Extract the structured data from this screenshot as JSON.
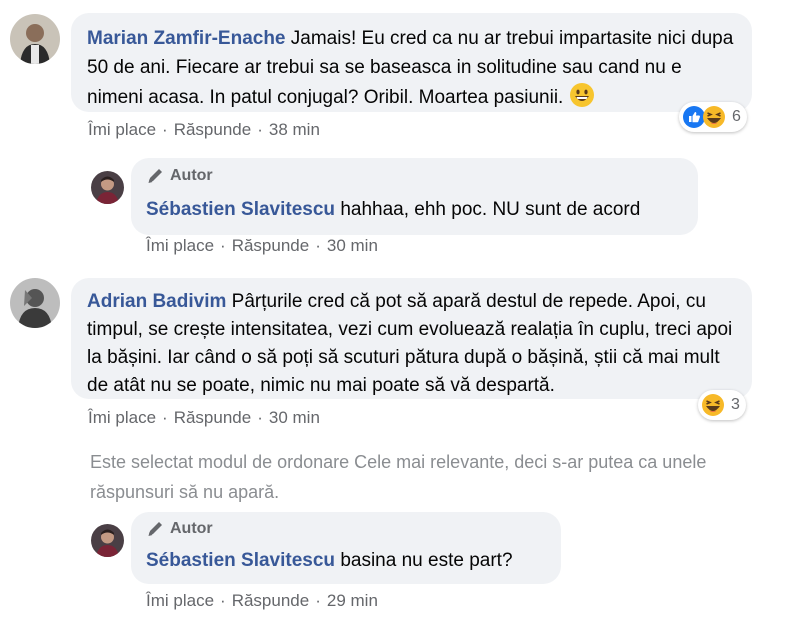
{
  "comments": [
    {
      "author": "Marian Zamfir-Enache",
      "text": "Jamais! Eu cred ca nu ar trebui impartasite nici dupa 50 de ani. Fiecare ar trebui sa se baseasca in solitudine sau cand nu e nimeni acasa. In patul conjugal? Oribil. Moartea pasiunii.",
      "like_label": "Îmi place",
      "reply_label": "Răspunde",
      "time": "38 min",
      "reaction_count": "6",
      "reaction_icons": [
        "like-icon",
        "haha-icon"
      ],
      "inline_emoji": "grinning-emoji-icon"
    },
    {
      "badge": "Autor",
      "author": "Sébastien Slavitescu",
      "text": "hahhaa, ehh poc. NU sunt de acord",
      "like_label": "Îmi place",
      "reply_label": "Răspunde",
      "time": "30 min"
    },
    {
      "author": "Adrian Badivim",
      "text": "Pârțurile cred că pot să apară destul de repede. Apoi, cu timpul, se crește intensitatea, vezi cum evoluează realația în cuplu, treci apoi la bășini. Iar când o să poți să scuturi pătura după o bășină, știi că mai mult de atât nu se poate, nimic nu mai poate să vă despartă.",
      "like_label": "Îmi place",
      "reply_label": "Răspunde",
      "time": "30 min",
      "reaction_count": "3",
      "reaction_icons": [
        "haha-icon"
      ]
    },
    {
      "badge": "Autor",
      "author": "Sébastien Slavitescu",
      "text": "basina nu este part?",
      "like_label": "Îmi place",
      "reply_label": "Răspunde",
      "time": "29 min"
    }
  ],
  "notice": "Este selectat modul de ordonare Cele mai relevante, deci s-ar putea ca unele răspunsuri să nu apară.",
  "colors": {
    "bubble": "#f0f2f5",
    "author": "#385898",
    "meta": "#65676b",
    "like_blue": "#1877f2",
    "haha_yellow": "#f7b928"
  }
}
